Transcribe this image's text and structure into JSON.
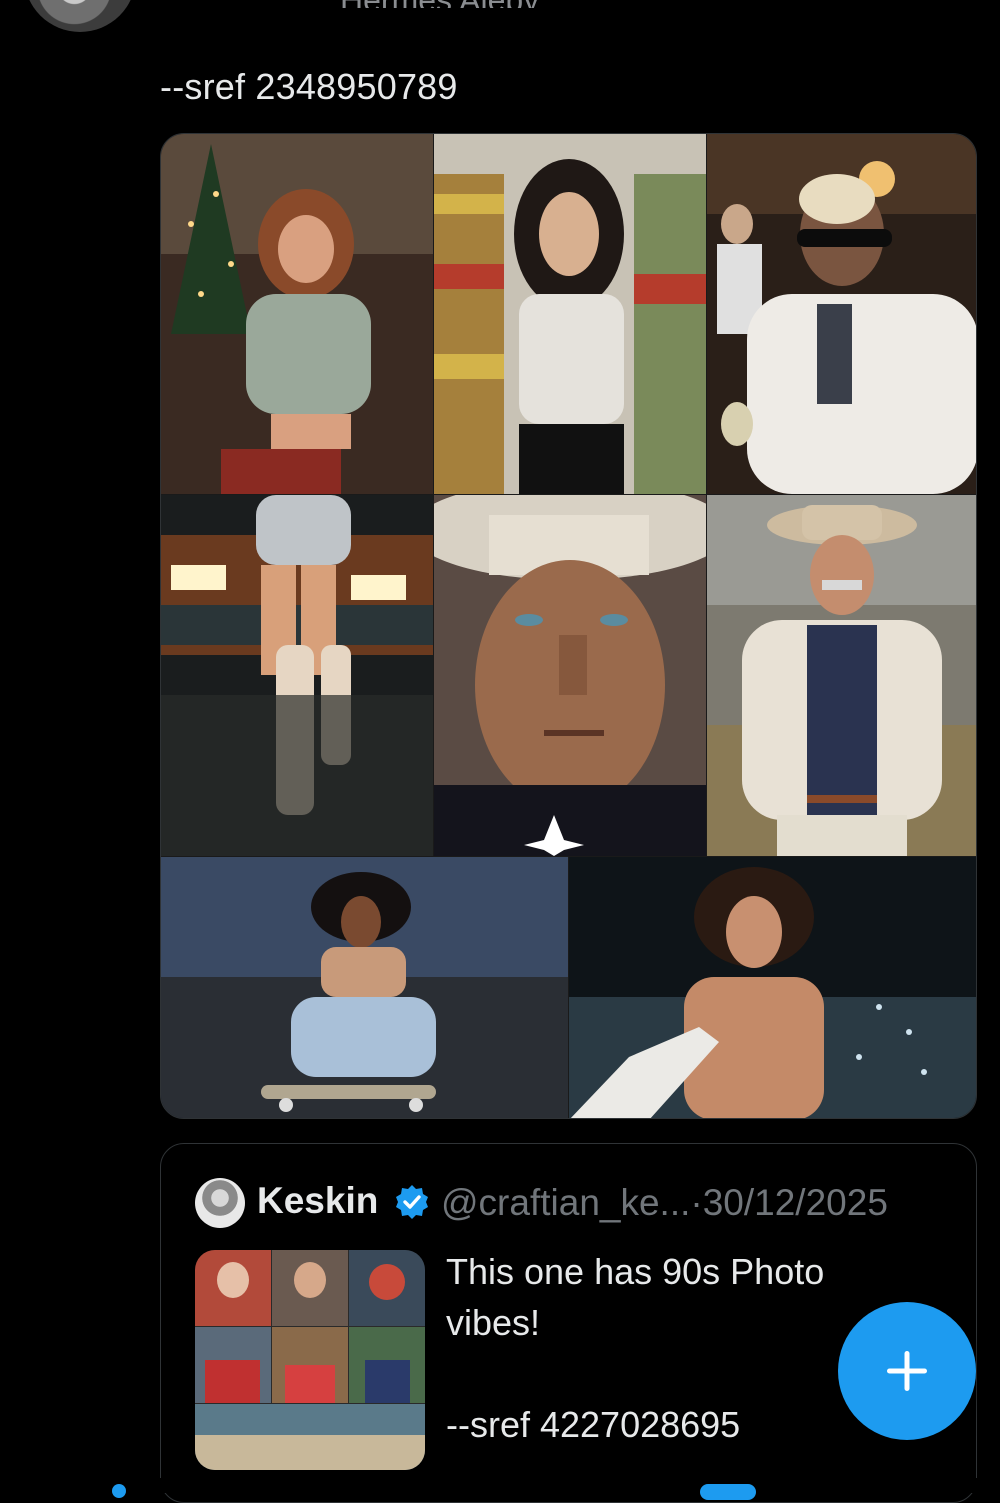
{
  "tweet": {
    "text": "--sref 2348950789",
    "top_fragment": "Hermes Ajeby"
  },
  "media": {
    "photos": [
      "christmas-party-woman-photo",
      "grocery-aisle-woman-photo",
      "bar-woman-fur-coat-photo",
      "woman-car-night-photo",
      "cowboy-closeup-photo",
      "cowboy-white-jacket-photo",
      "skateboarder-dusk-photo",
      "surfer-night-photo"
    ]
  },
  "quote": {
    "name": "Keskin",
    "handle": "@craftian_ke...",
    "separator": "·",
    "date": "30/12/2025",
    "text": "This one has 90s Photo\nvibes!\n\n--sref 4227028695",
    "verified_color": "#1d9bf0"
  },
  "fab": {
    "icon": "plus-icon",
    "color": "#1d9bf0"
  }
}
